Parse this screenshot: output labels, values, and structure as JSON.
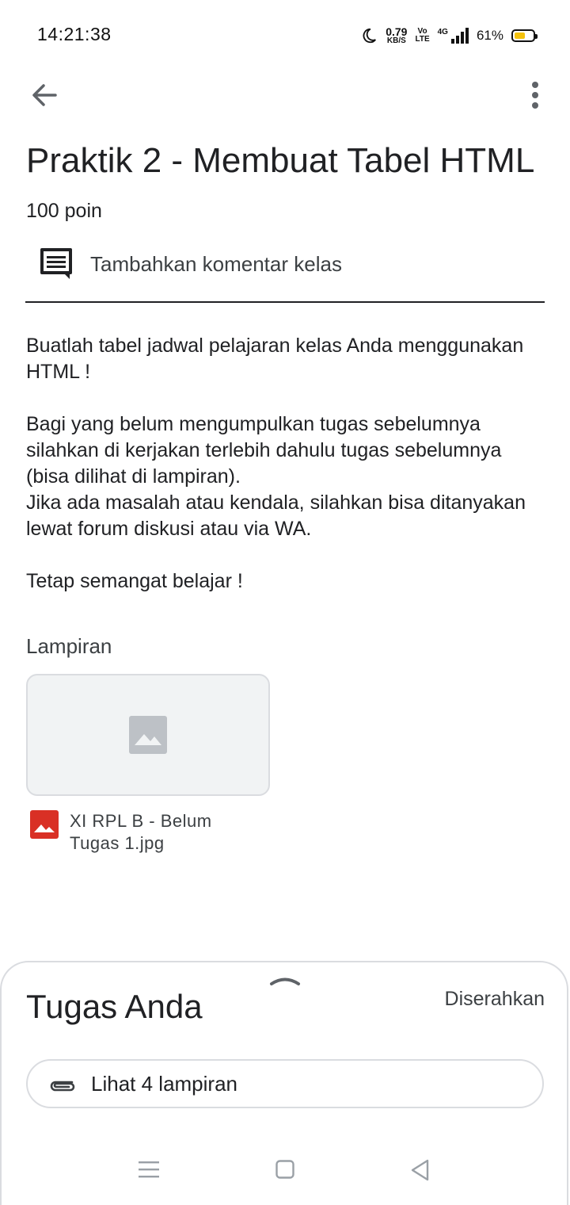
{
  "status_bar": {
    "time": "14:21:38",
    "net_speed_value": "0.79",
    "net_speed_unit": "KB/S",
    "volte_top": "Vo",
    "volte_bottom": "LTE",
    "network": "4G",
    "battery_percent": "61%",
    "battery_level": 0.61,
    "battery_color": "#f4c20d"
  },
  "assignment": {
    "title": "Praktik 2 - Membuat Tabel HTML",
    "points": "100 poin",
    "comment_prompt": "Tambahkan komentar kelas",
    "description": [
      "Buatlah tabel jadwal pelajaran kelas Anda menggunakan HTML !",
      "Bagi yang belum mengumpulkan tugas sebelumnya silahkan di kerjakan terlebih dahulu tugas sebelumnya (bisa dilihat di lampiran).\nJika ada masalah atau kendala, silahkan bisa ditanyakan lewat forum diskusi atau via WA.",
      "Tetap semangat belajar !"
    ],
    "attachments_label": "Lampiran",
    "attachment": {
      "file_name": "XI RPL B - Belum Tugas 1.jpg",
      "icon": "image-file-icon",
      "icon_color": "#d93025"
    }
  },
  "your_work": {
    "title": "Tugas Anda",
    "status": "Diserahkan",
    "view_attachments_label": "Lihat 4 lampiran"
  },
  "colors": {
    "text": "#202124",
    "secondary_text": "#3c4043",
    "border": "#dadce0"
  }
}
